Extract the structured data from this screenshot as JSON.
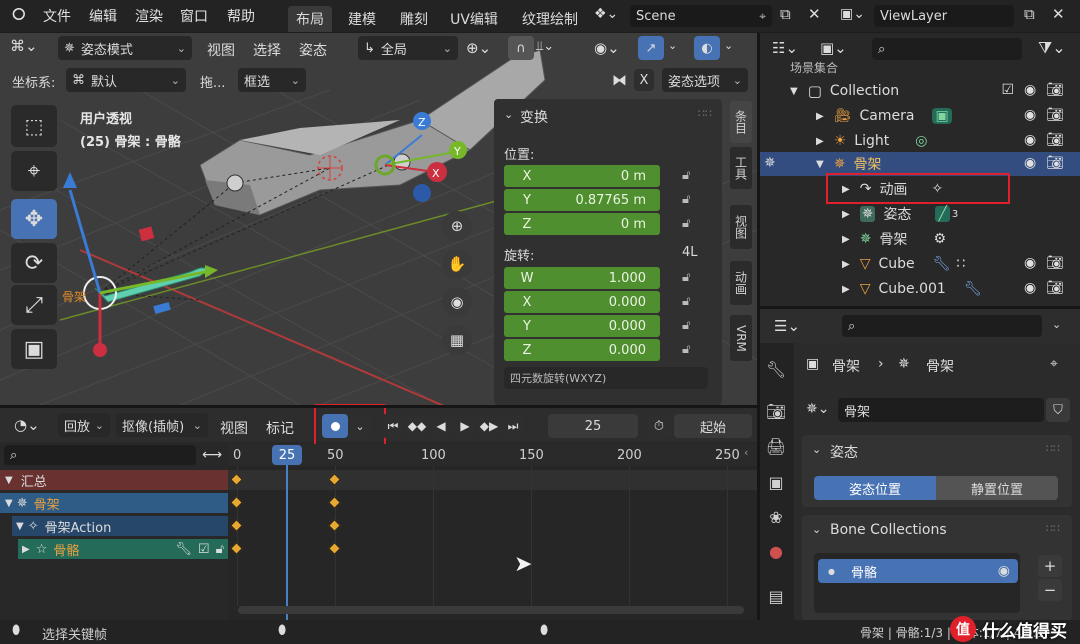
{
  "topbar": {
    "menus": [
      "文件",
      "编辑",
      "渲染",
      "窗口",
      "帮助"
    ],
    "workspace_tabs": [
      "布局",
      "建模",
      "雕刻",
      "UV编辑",
      "纹理绘制"
    ],
    "scene": "Scene",
    "view_layer": "ViewLayer"
  },
  "viewport": {
    "mode": "姿态模式",
    "menus": [
      "视图",
      "选择",
      "姿态"
    ],
    "transform_orientation": "全局",
    "coord_label": "坐标系:",
    "coord_value": "默认",
    "drag_label": "拖...",
    "drag_value": "框选",
    "x_badge": "X",
    "pose_options": "姿态选项",
    "title": "用户透视",
    "subtitle": "(25) 骨架 : 骨骼",
    "cursor_label": "骨架",
    "side_tabs": [
      "条目",
      "工具",
      "视图",
      "动画",
      "VRM"
    ]
  },
  "transform_panel": {
    "header": "变换",
    "location_label": "位置:",
    "location": [
      {
        "axis": "X",
        "value": "0 m"
      },
      {
        "axis": "Y",
        "value": "0.87765 m"
      },
      {
        "axis": "Z",
        "value": "0 m"
      }
    ],
    "rotation_label": "旋转:",
    "rotation_mode": "4L",
    "rotation": [
      {
        "axis": "W",
        "value": "1.000"
      },
      {
        "axis": "X",
        "value": "0.000"
      },
      {
        "axis": "Y",
        "value": "0.000"
      },
      {
        "axis": "Z",
        "value": "0.000"
      }
    ],
    "cut_text": "四元数旋转(WXYZ)"
  },
  "outliner": {
    "scene_collection": "场景集合",
    "items": [
      {
        "label": "Collection",
        "indent": 0
      },
      {
        "label": "Camera",
        "indent": 1
      },
      {
        "label": "Light",
        "indent": 1
      },
      {
        "label": "骨架",
        "indent": 1
      },
      {
        "label": "动画",
        "indent": 2
      },
      {
        "label": "姿态",
        "indent": 2
      },
      {
        "label": "骨架",
        "indent": 2
      },
      {
        "label": "Cube",
        "indent": 2
      },
      {
        "label": "Cube.001",
        "indent": 2
      }
    ],
    "pose_badge": "3",
    "highlight_color": "#e0202a"
  },
  "timeline": {
    "menus": [
      "回放",
      "抠像(插帧)",
      "视图",
      "标记"
    ],
    "current_frame": "25",
    "start_label": "起始",
    "ruler": [
      {
        "label": "0",
        "frame": 0
      },
      {
        "label": "25",
        "frame": 25
      },
      {
        "label": "50",
        "frame": 50
      },
      {
        "label": "100",
        "frame": 100
      },
      {
        "label": "150",
        "frame": 150
      },
      {
        "label": "200",
        "frame": 200
      },
      {
        "label": "250",
        "frame": 250
      }
    ],
    "channels": [
      "汇总",
      "骨架",
      "骨架Action",
      "骨骼"
    ],
    "key_frames": [
      0,
      50
    ],
    "record_color": "#4772b3"
  },
  "properties": {
    "breadcrumb_a": "骨架",
    "breadcrumb_b": "骨架",
    "data_name": "骨架",
    "pose_section": "姿态",
    "pose_position": "姿态位置",
    "rest_position": "静置位置",
    "bone_collections": "Bone Collections",
    "bone_item": "骨骼"
  },
  "statusbar": {
    "left": "选择关键帧",
    "right": "骨架 | 骨骼:1/3 | 物体:1/7 | 4.0.1",
    "watermark": "什么值得买"
  }
}
